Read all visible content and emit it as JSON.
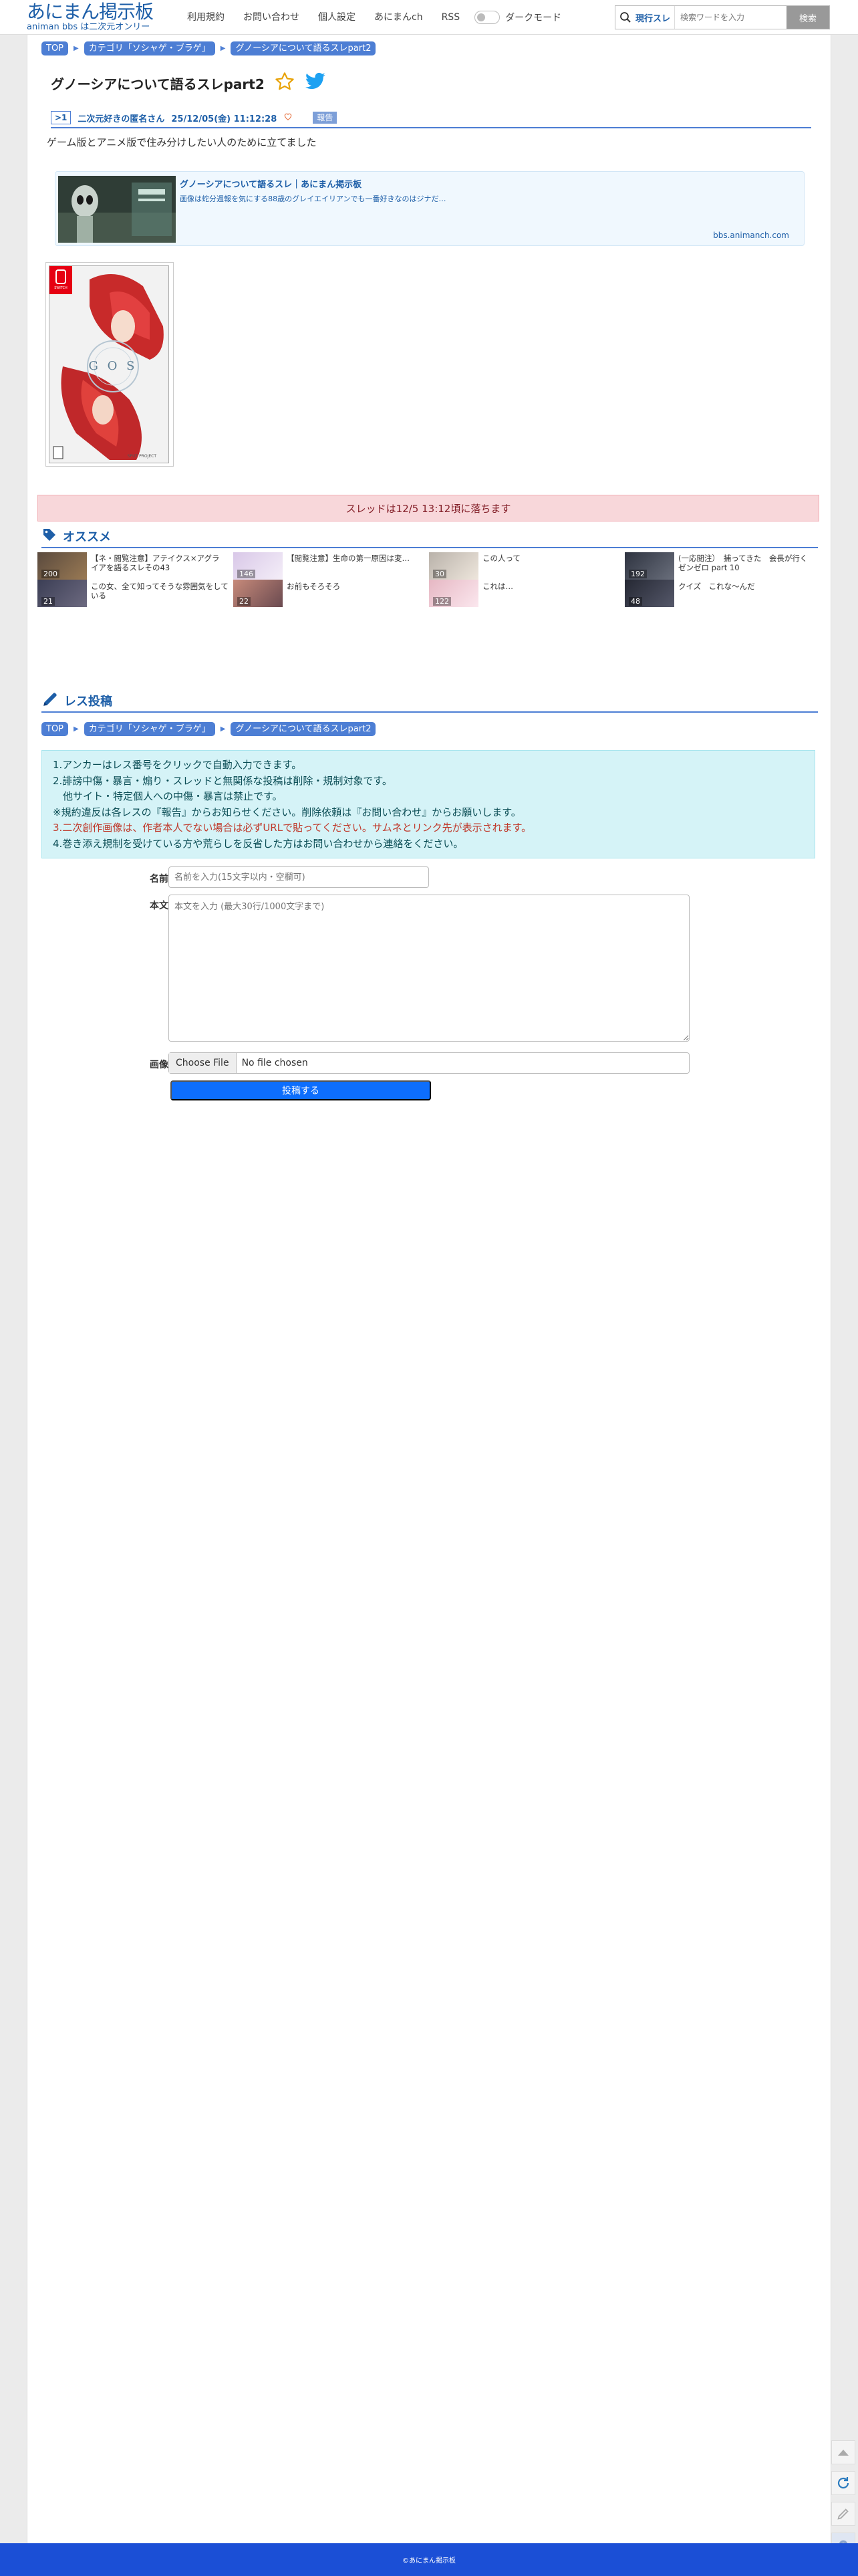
{
  "header": {
    "logo_main": "あにまん掲示板",
    "logo_sub": "animan bbs は二次元オンリー",
    "nav": [
      "利用規約",
      "お問い合わせ",
      "個人設定",
      "あにまんch",
      "RSS"
    ],
    "dark_mode_label": "ダークモード",
    "search_mode": "現行スレ",
    "search_placeholder": "検索ワードを入力",
    "search_button": "検索"
  },
  "breadcrumb": {
    "items": [
      "TOP",
      "カテゴリ「ソシャゲ・ブラゲ」",
      "グノーシアについて語るスレpart2"
    ]
  },
  "thread": {
    "title": "グノーシアについて語るスレpart2",
    "post": {
      "number": ">1",
      "name": "二次元好きの匿名さん",
      "date": "25/12/05(金) 11:12:28",
      "report_label": "報告",
      "body": "ゲーム版とアニメ版で住み分けしたい人のために立てました"
    }
  },
  "link_card": {
    "title": "グノーシアについて語るスレ｜あにまん掲示板",
    "description": "画像は蛇分週報を気にする88歳のグレイエイリアンでも一番好きなのはジナだ…",
    "domain": "bbs.animanch.com"
  },
  "cover": {
    "platform": "NINTENDO SWITCH",
    "title": "GNOSIA",
    "publisher": "SPUT PROJECT"
  },
  "notice": "スレッドは12/5 13:12頃に落ちます",
  "recommend": {
    "heading": "オススメ",
    "items": [
      {
        "title": "【ネ・閲覧注意】アテイクス×アグラ イアを語るスレその43",
        "count": "200"
      },
      {
        "title": "【閲覧注意】生命の第一原因は変…",
        "count": "146"
      },
      {
        "title": "この人って",
        "count": "30"
      },
      {
        "title": "(一応閲注）　捕ってきた　会長が行く ゼンゼロ part 10",
        "count": "192"
      },
      {
        "title": "この女、全て知ってそうな雰囲気をしている",
        "count": "21"
      },
      {
        "title": "お前もそろそろ",
        "count": "22"
      },
      {
        "title": "これは…",
        "count": "122"
      },
      {
        "title": "クイズ　これな～んだ",
        "count": "48"
      }
    ]
  },
  "reply": {
    "heading": "レス投稿",
    "rules": [
      "1.アンカーはレス番号をクリックで自動入力できます。",
      "2.誹謗中傷・暴言・煽り・スレッドと無関係な投稿は削除・規制対象です。",
      "　他サイト・特定個人への中傷・暴言は禁止です。",
      "※規約違反は各レスの『報告』からお知らせください。削除依頼は『お問い合わせ』からお願いします。",
      "3.二次創作画像は、作者本人でない場合は必ずURLで貼ってください。サムネとリンク先が表示されます。",
      "4.巻き添え規制を受けている方や荒らしを反省した方はお問い合わせから連絡をください。"
    ],
    "name_label": "名前",
    "name_placeholder": "名前を入力(15文字以内・空欄可)",
    "body_label": "本文",
    "body_placeholder": "本文を入力 (最大30行/1000文字まで)",
    "image_label": "画像",
    "file_button": "Choose File",
    "file_status": "No file chosen",
    "submit_label": "投稿する"
  },
  "footer": "©あにまん掲示板",
  "colors": {
    "accent": "#4d7ed4",
    "link": "#1e5fa8",
    "footer": "#1b4fd6",
    "notice_bg": "#f8d7da",
    "rules_bg": "#d5f3f7"
  }
}
